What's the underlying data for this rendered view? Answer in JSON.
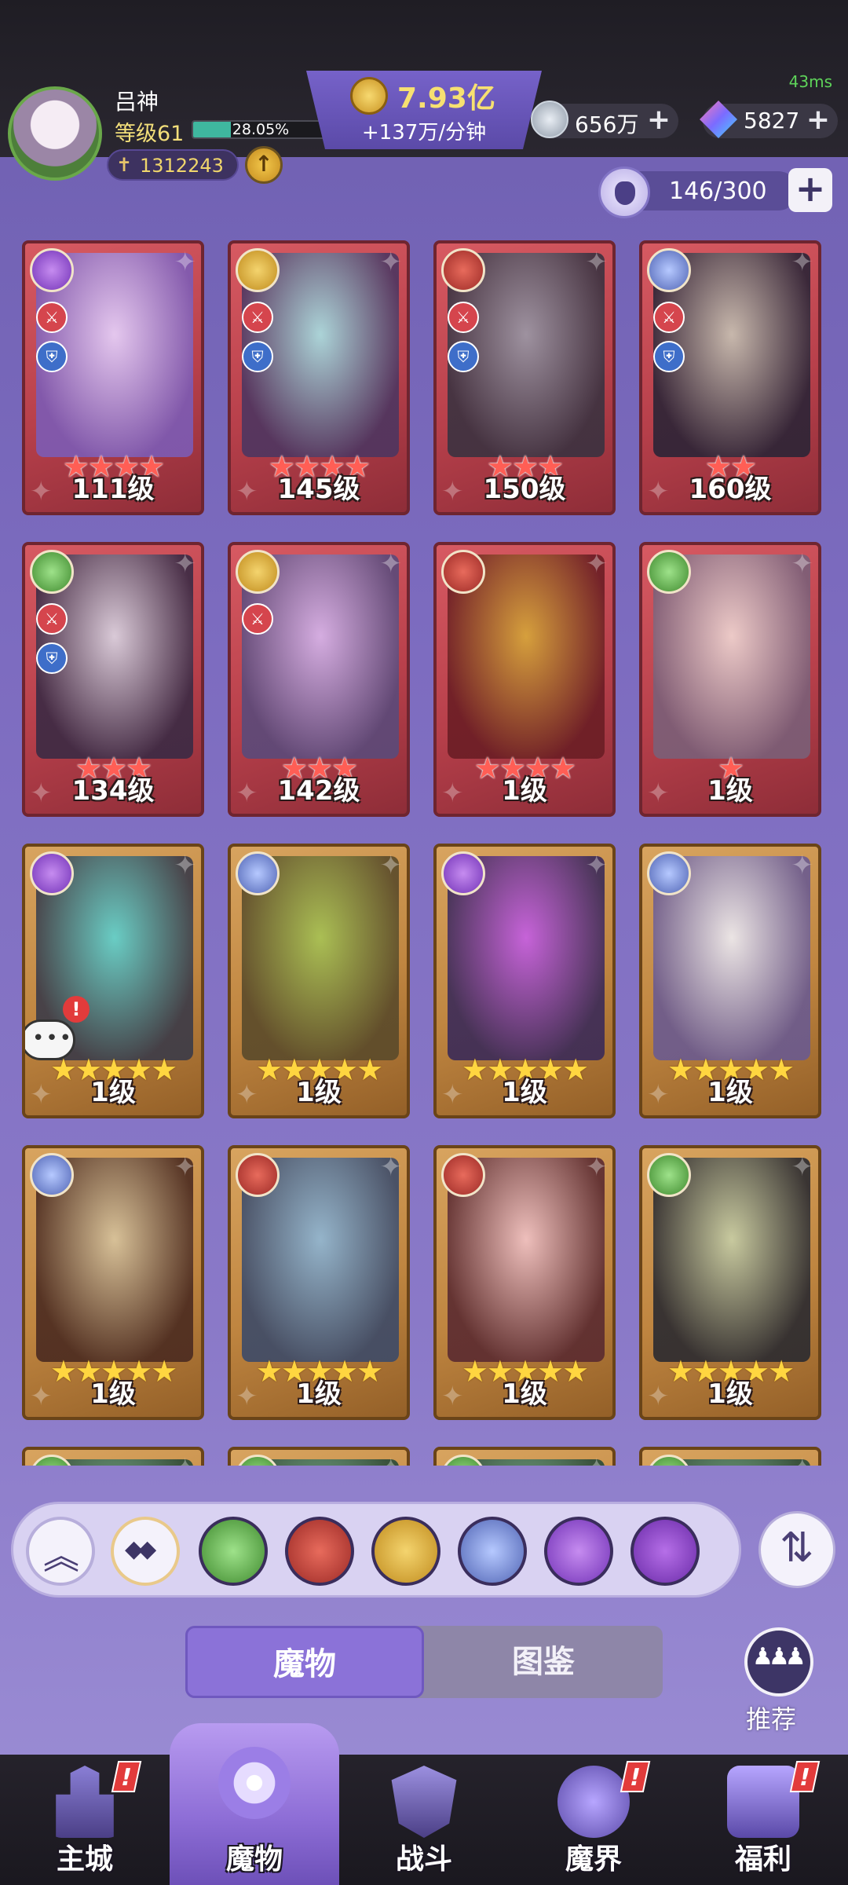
{
  "status": {
    "latency": "43ms"
  },
  "player": {
    "name": "吕神",
    "level_label": "等级61",
    "xp_percent_text": "28.05%",
    "xp_fraction": 0.2805,
    "power": "1312243"
  },
  "currency": {
    "gold_value": "7.93亿",
    "gold_rate": "+137万/分钟",
    "silver_value": "656万",
    "crystal_value": "5827"
  },
  "capacity": {
    "text": "146/300",
    "add_symbol": "+"
  },
  "cards": [
    {
      "level": "111级",
      "stars": "★★★★",
      "star_color": "red",
      "faction": "purple",
      "frame": "red",
      "badges": [
        "atk",
        "def"
      ],
      "portrait_colors": [
        "#e8d5ff",
        "#7c5bb5"
      ]
    },
    {
      "level": "145级",
      "stars": "★★★★",
      "star_color": "red",
      "faction": "gold",
      "frame": "red",
      "badges": [
        "atk",
        "def"
      ],
      "portrait_colors": [
        "#a9e3e6",
        "#4d3560"
      ]
    },
    {
      "level": "150级",
      "stars": "★★★",
      "star_color": "red",
      "faction": "red",
      "frame": "red",
      "badges": [
        "atk",
        "def"
      ],
      "portrait_colors": [
        "#9a9aa8",
        "#3a3240"
      ]
    },
    {
      "level": "160级",
      "stars": "★★",
      "star_color": "red",
      "faction": "blue",
      "frame": "red",
      "badges": [
        "atk",
        "def"
      ],
      "portrait_colors": [
        "#c8c4b6",
        "#2b2436"
      ]
    },
    {
      "level": "134级",
      "stars": "★★★",
      "star_color": "red",
      "faction": "green",
      "frame": "red",
      "badges": [
        "atk",
        "def"
      ],
      "portrait_colors": [
        "#dcd8e6",
        "#3a2a44"
      ]
    },
    {
      "level": "142级",
      "stars": "★★★",
      "star_color": "red",
      "faction": "gold",
      "frame": "red",
      "badges": [
        "atk"
      ],
      "portrait_colors": [
        "#d7b8f0",
        "#5a4a7a"
      ]
    },
    {
      "level": "1级",
      "stars": "★★★★",
      "star_color": "red",
      "faction": "red",
      "frame": "red",
      "badges": [],
      "portrait_colors": [
        "#d8a93a",
        "#6a1d24"
      ]
    },
    {
      "level": "1级",
      "stars": "★",
      "star_color": "red",
      "faction": "green",
      "frame": "red",
      "badges": [],
      "portrait_colors": [
        "#f1d8d4",
        "#7a5f78"
      ]
    },
    {
      "level": "1级",
      "stars": "★★★★★",
      "star_color": "gold",
      "faction": "purple",
      "frame": "gold",
      "badges": [],
      "portrait_colors": [
        "#5fd4d2",
        "#3a3a48"
      ],
      "chat": true
    },
    {
      "level": "1级",
      "stars": "★★★★★",
      "star_color": "gold",
      "faction": "blue",
      "frame": "gold",
      "badges": [],
      "portrait_colors": [
        "#a7c455",
        "#5a4a2a"
      ]
    },
    {
      "level": "1级",
      "stars": "★★★★★",
      "star_color": "gold",
      "faction": "purple",
      "frame": "gold",
      "badges": [],
      "portrait_colors": [
        "#c65ee8",
        "#3a2a58"
      ]
    },
    {
      "level": "1级",
      "stars": "★★★★★",
      "star_color": "gold",
      "faction": "blue",
      "frame": "gold",
      "badges": [],
      "portrait_colors": [
        "#efeef5",
        "#6a5a90"
      ]
    },
    {
      "level": "1级",
      "stars": "★★★★★",
      "star_color": "gold",
      "faction": "blue",
      "frame": "gold",
      "badges": [],
      "portrait_colors": [
        "#d9c6a0",
        "#4a2a20"
      ]
    },
    {
      "level": "1级",
      "stars": "★★★★★",
      "star_color": "gold",
      "faction": "red",
      "frame": "gold",
      "badges": [],
      "portrait_colors": [
        "#8fb8d8",
        "#3c4a68"
      ]
    },
    {
      "level": "1级",
      "stars": "★★★★★",
      "star_color": "gold",
      "faction": "red",
      "frame": "gold",
      "badges": [],
      "portrait_colors": [
        "#f2c4c8",
        "#5a2a30"
      ]
    },
    {
      "level": "1级",
      "stars": "★★★★★",
      "star_color": "gold",
      "faction": "green",
      "frame": "gold",
      "badges": [],
      "portrait_colors": [
        "#c8d0a8",
        "#2a2a30"
      ]
    },
    {
      "level": "",
      "stars": "",
      "star_color": "gold",
      "faction": "green",
      "frame": "gold",
      "badges": [],
      "portrait_colors": [
        "#7ac0a0",
        "#2a4a3a"
      ]
    },
    {
      "level": "",
      "stars": "",
      "star_color": "gold",
      "faction": "green",
      "frame": "gold",
      "badges": [],
      "portrait_colors": [
        "#7ac0a0",
        "#2a4a3a"
      ]
    },
    {
      "level": "",
      "stars": "",
      "star_color": "gold",
      "faction": "green",
      "frame": "gold",
      "badges": [],
      "portrait_colors": [
        "#7ac0a0",
        "#2a4a3a"
      ]
    },
    {
      "level": "",
      "stars": "",
      "star_color": "gold",
      "faction": "green",
      "frame": "gold",
      "badges": [],
      "portrait_colors": [
        "#7ac0a0",
        "#2a4a3a"
      ]
    }
  ],
  "filters": [
    {
      "name": "collapse-filter-button",
      "icon": "double-chevron-up-icon"
    },
    {
      "name": "filter-all-button",
      "icon": "diamond-grid-icon"
    },
    {
      "name": "filter-nature-button",
      "icon": "leaf-icon"
    },
    {
      "name": "filter-demon-button",
      "icon": "demon-mask-icon"
    },
    {
      "name": "filter-time-button",
      "icon": "hourglass-icon"
    },
    {
      "name": "filter-dragon-button",
      "icon": "dragon-head-icon"
    },
    {
      "name": "filter-eye-button",
      "icon": "eye-icon"
    },
    {
      "name": "filter-star-button",
      "icon": "star-emblem-icon"
    }
  ],
  "tabs": {
    "monsters": "魔物",
    "codex": "图鉴"
  },
  "recommend": {
    "label": "推荐"
  },
  "nav": [
    {
      "label": "主城",
      "icon": "castle-icon",
      "alert": "!"
    },
    {
      "label": "魔物",
      "icon": "purple-flame-icon",
      "active": true
    },
    {
      "label": "战斗",
      "icon": "sword-shield-icon"
    },
    {
      "label": "魔界",
      "icon": "demon-realm-icon",
      "alert": "!"
    },
    {
      "label": "福利",
      "icon": "treasure-chest-icon",
      "alert": "!"
    }
  ]
}
